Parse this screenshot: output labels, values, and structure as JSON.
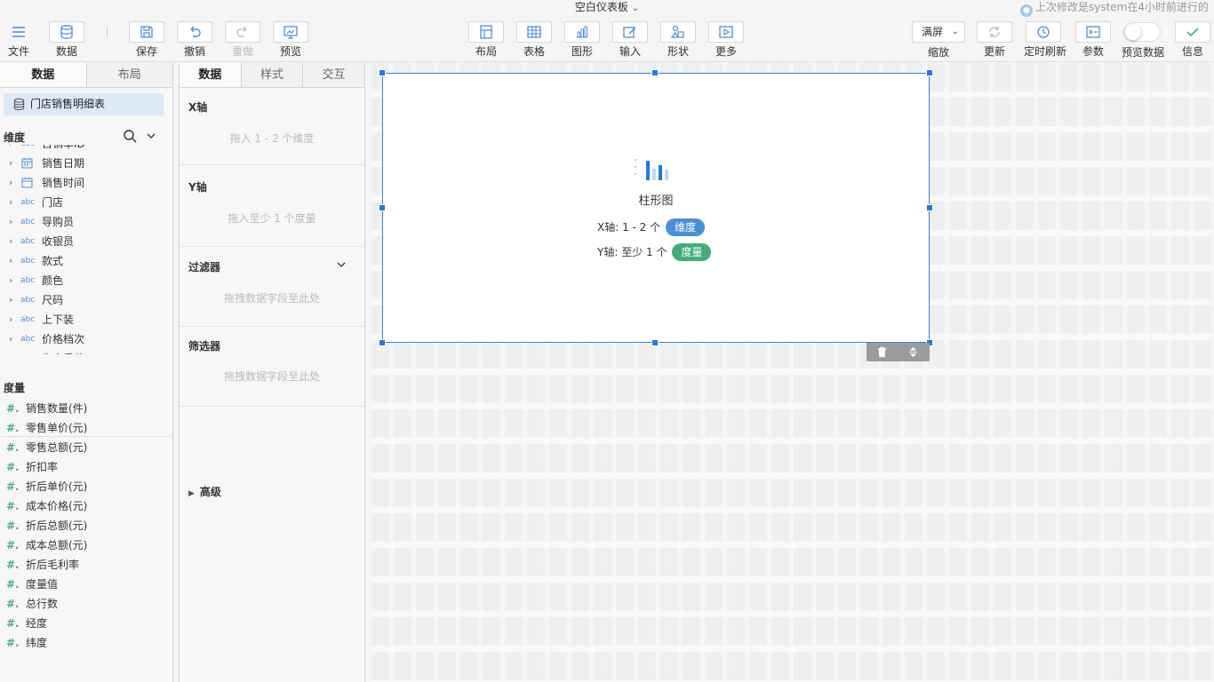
{
  "title": "空白仪表板",
  "last_modified": "上次修改是system在4小时前进行的",
  "toolbar": {
    "file": "文件",
    "data": "数据",
    "save": "保存",
    "undo": "撤销",
    "redo": "重做",
    "preview": "预览",
    "layout": "布局",
    "table": "表格",
    "chart": "图形",
    "input": "输入",
    "shape": "形状",
    "more": "更多",
    "zoom_value": "满屏",
    "zoom": "缩放",
    "refresh": "更新",
    "timed_refresh": "定时刷新",
    "params": "参数",
    "preview_data": "预览数据",
    "info": "信息"
  },
  "left_panel": {
    "tabs": [
      "数据",
      "布局"
    ],
    "active_tab": "数据",
    "dataset": "门店销售明细表",
    "dimension_header": "维度",
    "dimensions": [
      {
        "type": "abc",
        "name": "日销单ID"
      },
      {
        "type": "date",
        "name": "销售日期"
      },
      {
        "type": "time",
        "name": "销售时间"
      },
      {
        "type": "abc",
        "name": "门店"
      },
      {
        "type": "abc",
        "name": "导购员"
      },
      {
        "type": "abc",
        "name": "收银员"
      },
      {
        "type": "abc",
        "name": "款式"
      },
      {
        "type": "abc",
        "name": "颜色"
      },
      {
        "type": "abc",
        "name": "尺码"
      },
      {
        "type": "abc",
        "name": "上下装"
      },
      {
        "type": "abc",
        "name": "价格档次"
      },
      {
        "type": "abc",
        "name": "生产季节"
      }
    ],
    "measure_header": "度量",
    "measures": [
      "销售数量(件)",
      "零售单价(元)",
      "零售总额(元)",
      "折扣率",
      "折后单价(元)",
      "成本价格(元)",
      "折后总额(元)",
      "成本总额(元)",
      "折后毛利率",
      "度量值",
      "总行数",
      "经度",
      "纬度"
    ]
  },
  "prop_panel": {
    "tabs": [
      "数据",
      "样式",
      "交互"
    ],
    "active_tab": "数据",
    "x_axis": {
      "title": "X轴",
      "hint": "拖入 1 - 2 个维度"
    },
    "y_axis": {
      "title": "Y轴",
      "hint": "拖入至少 1 个度量"
    },
    "filter": {
      "title": "过滤器",
      "hint": "拖拽数据字段至此处"
    },
    "selector": {
      "title": "筛选器",
      "hint": "拖拽数据字段至此处"
    },
    "advanced": "高级"
  },
  "widget": {
    "name": "柱形图",
    "x_label": "X轴: 1 - 2 个",
    "x_pill": "维度",
    "y_label": "Y轴: 至少 1 个",
    "y_pill": "度量"
  },
  "colors": {
    "accent": "#1e7be0",
    "dimension_pill": "#4a90d9",
    "measure_pill": "#3fae7a"
  }
}
